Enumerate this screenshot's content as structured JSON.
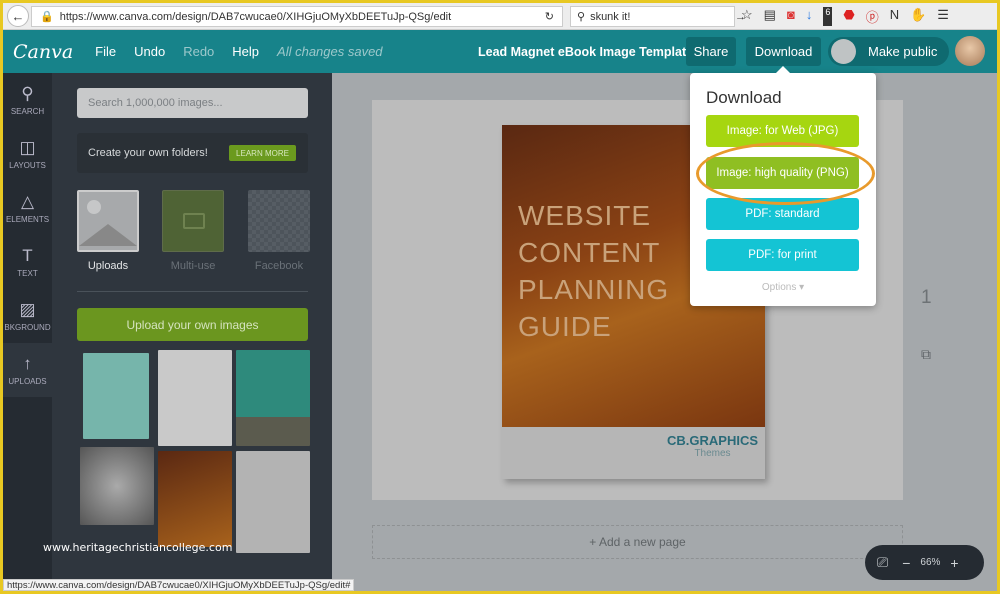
{
  "browser": {
    "url": "https://www.canva.com/design/DAB7cwucae0/XIHGjuOMyXbDEETuJp-QSg/edit",
    "search": "skunk it!",
    "badge": "6",
    "status_url": "https://www.canva.com/design/DAB7cwucae0/XIHGjuOMyXbDEETuJp-QSg/edit#"
  },
  "header": {
    "logo": "Canva",
    "menu": [
      "File",
      "Undo",
      "Redo",
      "Help"
    ],
    "saved": "All changes saved",
    "title": "Lead Magnet eBook Image Template",
    "share": "Share",
    "download": "Download",
    "make_public": "Make public"
  },
  "rail": [
    {
      "icon": "search-icon",
      "glyph": "⚲",
      "label": "SEARCH"
    },
    {
      "icon": "layouts-icon",
      "glyph": "◫",
      "label": "LAYOUTS"
    },
    {
      "icon": "elements-icon",
      "glyph": "△",
      "label": "ELEMENTS"
    },
    {
      "icon": "text-icon",
      "glyph": "T",
      "label": "TEXT"
    },
    {
      "icon": "background-icon",
      "glyph": "▨",
      "label": "BKGROUND"
    },
    {
      "icon": "uploads-icon",
      "glyph": "↑",
      "label": "UPLOADS"
    }
  ],
  "panel": {
    "search_placeholder": "Search 1,000,000 images...",
    "promo": "Create your own folders!",
    "learn_more": "LEARN MORE",
    "folders": [
      "Uploads",
      "Multi-use",
      "Facebook"
    ],
    "upload_button": "Upload your own images"
  },
  "canvas": {
    "cover_title": [
      "WEBSITE",
      "CONTENT",
      "PLANNING",
      "GUIDE"
    ],
    "brand": "CB.GRAPHICS",
    "brand_sub": "Themes",
    "add_page": "+ Add a new page",
    "page_number": "1"
  },
  "zoom": {
    "minus": "−",
    "level": "66%",
    "plus": "+"
  },
  "download_menu": {
    "title": "Download",
    "options": [
      {
        "label": "Image: for Web (JPG)",
        "color": "#a6d610"
      },
      {
        "label": "Image: high quality (PNG)",
        "color": "#8fbf22"
      },
      {
        "label": "PDF: standard",
        "color": "#14c4d4"
      },
      {
        "label": "PDF: for print",
        "color": "#14c4d4"
      }
    ],
    "more": "Options ▾",
    "highlight_color": "#e89a2c"
  },
  "watermark": "www.heritagechristiancollege.com"
}
